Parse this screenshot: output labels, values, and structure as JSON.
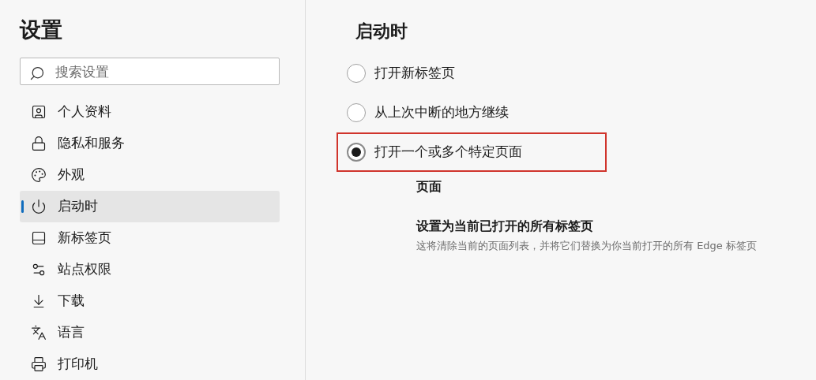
{
  "sidebar": {
    "title": "设置",
    "search": {
      "placeholder": "搜索设置"
    },
    "items": [
      {
        "label": "个人资料",
        "selected": false
      },
      {
        "label": "隐私和服务",
        "selected": false
      },
      {
        "label": "外观",
        "selected": false
      },
      {
        "label": "启动时",
        "selected": true
      },
      {
        "label": "新标签页",
        "selected": false
      },
      {
        "label": "站点权限",
        "selected": false
      },
      {
        "label": "下载",
        "selected": false
      },
      {
        "label": "语言",
        "selected": false
      },
      {
        "label": "打印机",
        "selected": false
      }
    ]
  },
  "main": {
    "heading": "启动时",
    "options": [
      {
        "label": "打开新标签页",
        "selected": false,
        "highlighted": false
      },
      {
        "label": "从上次中断的地方继续",
        "selected": false,
        "highlighted": false
      },
      {
        "label": "打开一个或多个特定页面",
        "selected": true,
        "highlighted": true
      }
    ],
    "pages": {
      "heading": "页面",
      "action": {
        "title": "设置为当前已打开的所有标签页",
        "description": "这将清除当前的页面列表，并将它们替换为你当前打开的所有 Edge 标签页"
      }
    }
  }
}
